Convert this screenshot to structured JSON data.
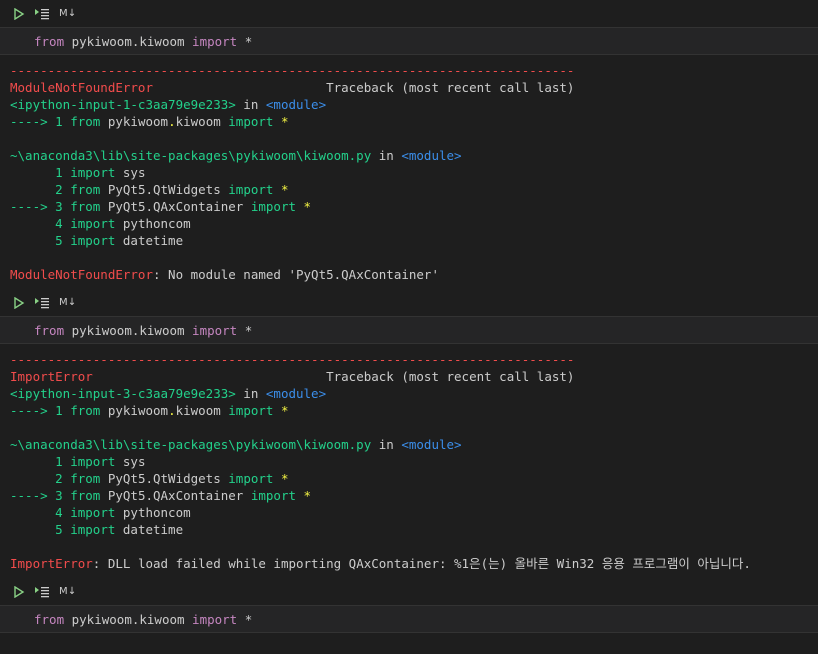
{
  "toolbar": {
    "md_label": "M↓"
  },
  "cells": [
    {
      "code": {
        "kw_from": "from",
        "module": " pykiwoom.kiwoom ",
        "kw_import": "import",
        "rest": " *"
      },
      "output": {
        "dash_line": "---------------------------------------------------------------------------",
        "error_name": "ModuleNotFoundError",
        "traceback_pad": "                       ",
        "traceback_label": "Traceback (most recent call last)",
        "input_ref": "<ipython-input-1-c3aa79e9e233>",
        "in_word": " in ",
        "module_ref": "<module>",
        "arrow_line": {
          "arrow": "----> 1 ",
          "from": "from",
          "mod1": " pykiwoom",
          "dot": ".",
          "mod2": "kiwoom ",
          "imp": "import",
          "star": " *"
        },
        "file_path": "~\\anaconda3\\lib\\site-packages\\pykiwoom\\kiwoom.py",
        "file_in": " in ",
        "file_module": "<module>",
        "src_lines": [
          {
            "prefix": "      1 ",
            "kw": "import",
            "rest": " sys",
            "imp": "",
            "star": ""
          },
          {
            "prefix": "      2 ",
            "kw": "from",
            "rest": " PyQt5.QtWidgets ",
            "imp": "import",
            "star": " *"
          },
          {
            "prefix": "----> 3 ",
            "kw": "from",
            "rest": " PyQt5.QAxContainer ",
            "imp": "import",
            "star": " *"
          },
          {
            "prefix": "      4 ",
            "kw": "import",
            "rest": " pythoncom",
            "imp": "",
            "star": ""
          },
          {
            "prefix": "      5 ",
            "kw": "import",
            "rest": " datetime",
            "imp": "",
            "star": ""
          }
        ],
        "final_error": "ModuleNotFoundError",
        "final_msg": ": No module named 'PyQt5.QAxContainer'"
      }
    },
    {
      "code": {
        "kw_from": "from",
        "module": " pykiwoom.kiwoom ",
        "kw_import": "import",
        "rest": " *"
      },
      "output": {
        "dash_line": "---------------------------------------------------------------------------",
        "error_name": "ImportError",
        "traceback_pad": "                               ",
        "traceback_label": "Traceback (most recent call last)",
        "input_ref": "<ipython-input-3-c3aa79e9e233>",
        "in_word": " in ",
        "module_ref": "<module>",
        "arrow_line": {
          "arrow": "----> 1 ",
          "from": "from",
          "mod1": " pykiwoom",
          "dot": ".",
          "mod2": "kiwoom ",
          "imp": "import",
          "star": " *"
        },
        "file_path": "~\\anaconda3\\lib\\site-packages\\pykiwoom\\kiwoom.py",
        "file_in": " in ",
        "file_module": "<module>",
        "src_lines": [
          {
            "prefix": "      1 ",
            "kw": "import",
            "rest": " sys",
            "imp": "",
            "star": ""
          },
          {
            "prefix": "      2 ",
            "kw": "from",
            "rest": " PyQt5.QtWidgets ",
            "imp": "import",
            "star": " *"
          },
          {
            "prefix": "----> 3 ",
            "kw": "from",
            "rest": " PyQt5.QAxContainer ",
            "imp": "import",
            "star": " *"
          },
          {
            "prefix": "      4 ",
            "kw": "import",
            "rest": " pythoncom",
            "imp": "",
            "star": ""
          },
          {
            "prefix": "      5 ",
            "kw": "import",
            "rest": " datetime",
            "imp": "",
            "star": ""
          }
        ],
        "final_error": "ImportError",
        "final_msg": ": DLL load failed while importing QAxContainer: %1은(는) 올바른 Win32 응용 프로그램이 아닙니다."
      }
    },
    {
      "code": {
        "kw_from": "from",
        "module": " pykiwoom.kiwoom ",
        "kw_import": "import",
        "rest": " *"
      }
    }
  ]
}
